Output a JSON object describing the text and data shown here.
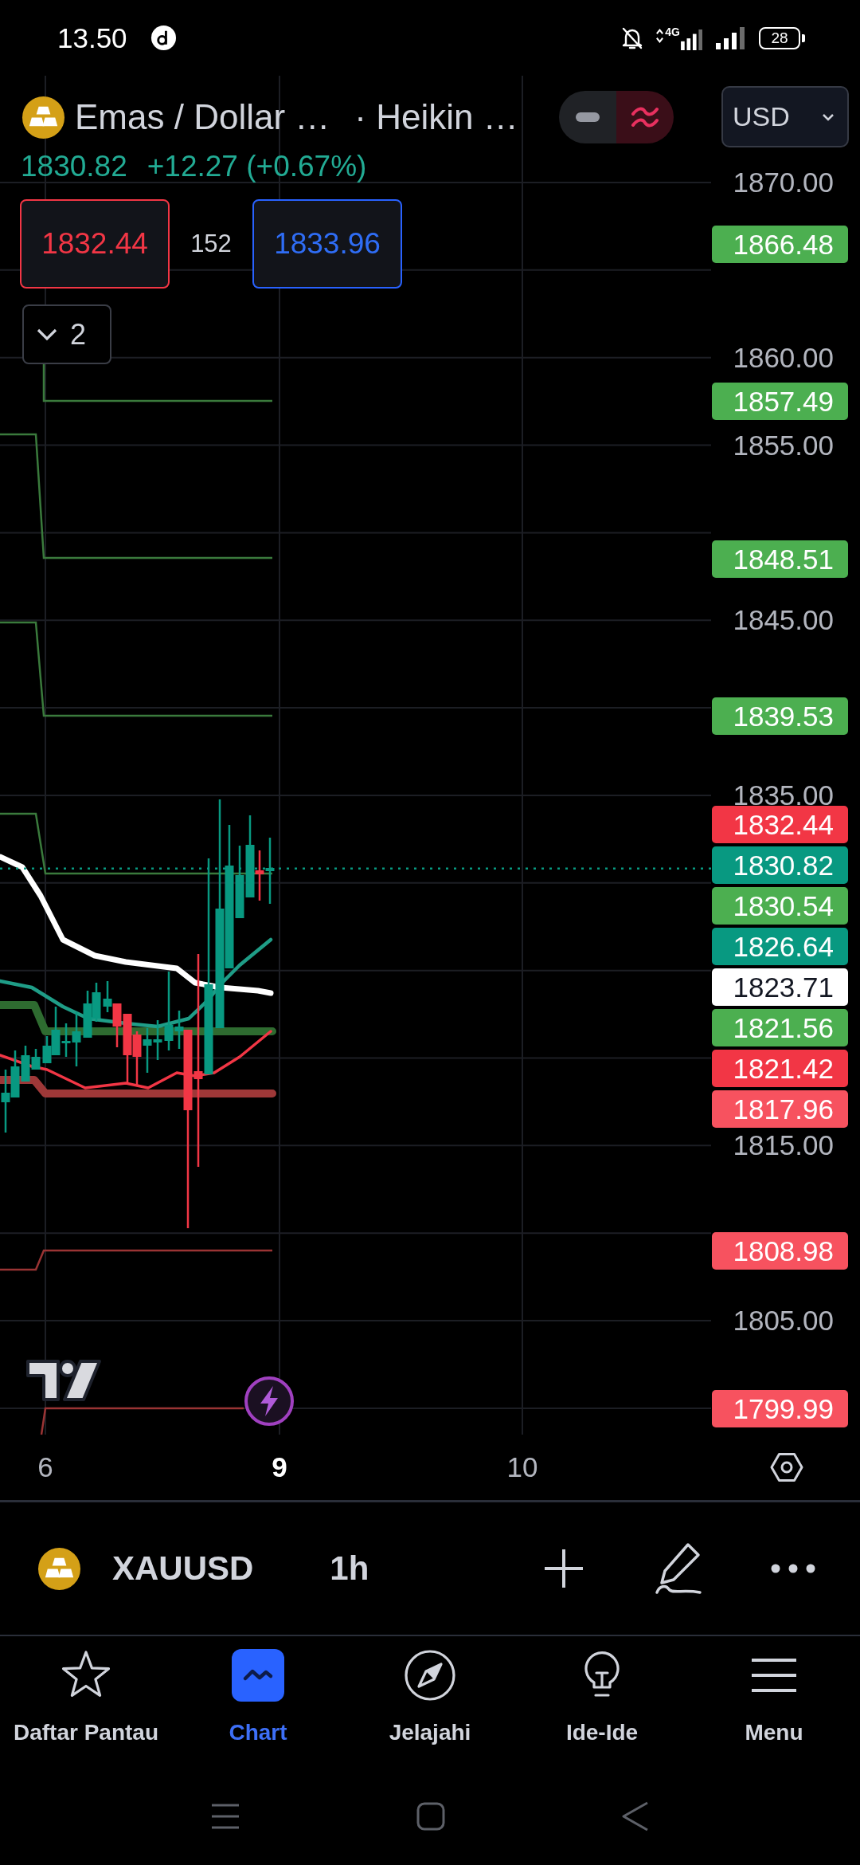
{
  "status_bar": {
    "time": "13.50",
    "network_type": "4G",
    "battery": "28"
  },
  "legend": {
    "symbol_name": "Emas / Dollar …",
    "chart_type": "· Heikin …",
    "price": "1830.82",
    "change": "+12.27 (+0.67%)",
    "sell_price": "1832.44",
    "spread": "152",
    "buy_price": "1833.96",
    "collapsed_count": "2"
  },
  "currency_selector": {
    "value": "USD"
  },
  "price_axis": {
    "ticks": [
      "1870.00",
      "1860.00",
      "1855.00",
      "1845.00",
      "1835.00",
      "1815.00",
      "1805.00"
    ]
  },
  "price_badges": [
    {
      "value": "1866.48",
      "color": "#4caf50"
    },
    {
      "value": "1857.49",
      "color": "#4caf50"
    },
    {
      "value": "1848.51",
      "color": "#4caf50"
    },
    {
      "value": "1839.53",
      "color": "#4caf50"
    },
    {
      "value": "1832.44",
      "color": "#f23645"
    },
    {
      "value": "1830.82",
      "color": "#089981"
    },
    {
      "value": "1830.54",
      "color": "#4caf50"
    },
    {
      "value": "1826.64",
      "color": "#089981"
    },
    {
      "value": "1823.71",
      "color": "#ffffff"
    },
    {
      "value": "1821.56",
      "color": "#4caf50"
    },
    {
      "value": "1821.42",
      "color": "#f23645"
    },
    {
      "value": "1817.96",
      "color": "#f7525f"
    },
    {
      "value": "1808.98",
      "color": "#f7525f"
    },
    {
      "value": "1799.99",
      "color": "#f7525f"
    }
  ],
  "time_axis": {
    "labels": [
      {
        "text": "6",
        "major": false
      },
      {
        "text": "9",
        "major": true
      },
      {
        "text": "10",
        "major": false
      }
    ]
  },
  "toolbar": {
    "symbol": "XAUUSD",
    "interval": "1h"
  },
  "bottom_nav": [
    {
      "label": "Daftar Pantau",
      "selected": false
    },
    {
      "label": "Chart",
      "selected": true
    },
    {
      "label": "Jelajahi",
      "selected": false
    },
    {
      "label": "Ide-Ide",
      "selected": false
    },
    {
      "label": "Menu",
      "selected": false
    }
  ]
}
